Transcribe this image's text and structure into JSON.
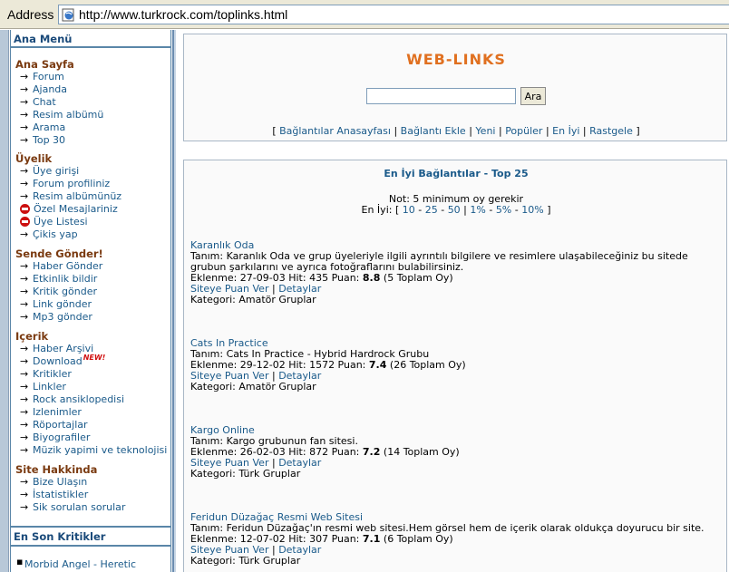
{
  "browser": {
    "address_label": "Address",
    "url": "http://www.turkrock.com/toplinks.html"
  },
  "menu": {
    "title": "Ana Menü",
    "sections": [
      {
        "title": "Ana Sayfa",
        "items": [
          "Forum",
          "Ajanda",
          "Chat",
          "Resim albümü",
          "Arama",
          "Top 30"
        ]
      },
      {
        "title": "Üyelik",
        "items": [
          "Üye girişi",
          "Forum profiliniz",
          "Resim albümünüz",
          "Özel Mesajlariniz",
          "Üye Listesi",
          "Çikis yap"
        ]
      },
      {
        "title": "Sende Gönder!",
        "items": [
          "Haber Gönder",
          "Etkinlik bildir",
          "Kritik gönder",
          "Link gönder",
          "Mp3 gönder"
        ]
      },
      {
        "title": "Içerik",
        "items": [
          "Haber Arşivi",
          "Download",
          "Kritikler",
          "Linkler",
          "Rock ansiklopedisi",
          "Izlenimler",
          "Röportajlar",
          "Biyografiler",
          "Müzik yapimi ve teknolojisi"
        ]
      },
      {
        "title": "Site Hakkinda",
        "items": [
          "Bize Ulaşın",
          "İstatistikler",
          "Sik sorulan sorular"
        ]
      }
    ],
    "new_badge": "NEW!",
    "critics_title": "En Son Kritikler",
    "critics_items": [
      "Morbid Angel - Heretic"
    ]
  },
  "header": {
    "logo": "WEB-LINKS",
    "search_button": "Ara",
    "search_value": "",
    "nav_open": "[",
    "nav_close": "]",
    "nav": [
      "Bağlantılar Anasayfası",
      "Bağlantı Ekle",
      "Yeni",
      "Popüler",
      "En İyi",
      "Rastgele"
    ]
  },
  "list": {
    "title": "En İyi Bağlantılar - Top 25",
    "note": "Not: 5 minimum oy gerekir",
    "best_label": "En İyi:",
    "best_open": "[",
    "best_close": "]",
    "best_links": [
      "10",
      "25",
      "50",
      "1%",
      "5%",
      "10%"
    ],
    "entries": [
      {
        "name": "Karanlık Oda",
        "desc": "Tanım: Karanlık Oda ve grup üyeleriyle ilgili ayrıntılı bilgilere ve resimlere ulaşabileceğiniz bu sitede grubun şarkılarını ve ayrıca fotoğraflarını bulabilirsiniz.",
        "added": "Eklenme: 27-09-03 Hit: 435 Puan:",
        "score": "8.8",
        "votes": "(5 Toplam Oy)",
        "rate": "Siteye Puan Ver",
        "details": "Detaylar",
        "category": "Kategori: Amatör Gruplar"
      },
      {
        "name": "Cats In Practice",
        "desc": "Tanım: Cats In Practice - Hybrid Hardrock Grubu",
        "added": "Eklenme: 29-12-02 Hit: 1572 Puan:",
        "score": "7.4",
        "votes": "(26 Toplam Oy)",
        "rate": "Siteye Puan Ver",
        "details": "Detaylar",
        "category": "Kategori: Amatör Gruplar"
      },
      {
        "name": "Kargo Online",
        "desc": "Tanım: Kargo grubunun fan sitesi.",
        "added": "Eklenme: 26-02-03 Hit: 872 Puan:",
        "score": "7.2",
        "votes": "(14 Toplam Oy)",
        "rate": "Siteye Puan Ver",
        "details": "Detaylar",
        "category": "Kategori: Türk Gruplar"
      },
      {
        "name": "Feridun Düzağaç Resmi Web Sitesi",
        "desc": "Tanım: Feridun Düzağaç'ın resmi web sitesi.Hem görsel hem de içerik olarak oldukça doyurucu bir site.",
        "added": "Eklenme: 12-07-02 Hit: 307 Puan:",
        "score": "7.1",
        "votes": "(6 Toplam Oy)",
        "rate": "Siteye Puan Ver",
        "details": "Detaylar",
        "category": "Kategori: Türk Gruplar"
      }
    ]
  }
}
